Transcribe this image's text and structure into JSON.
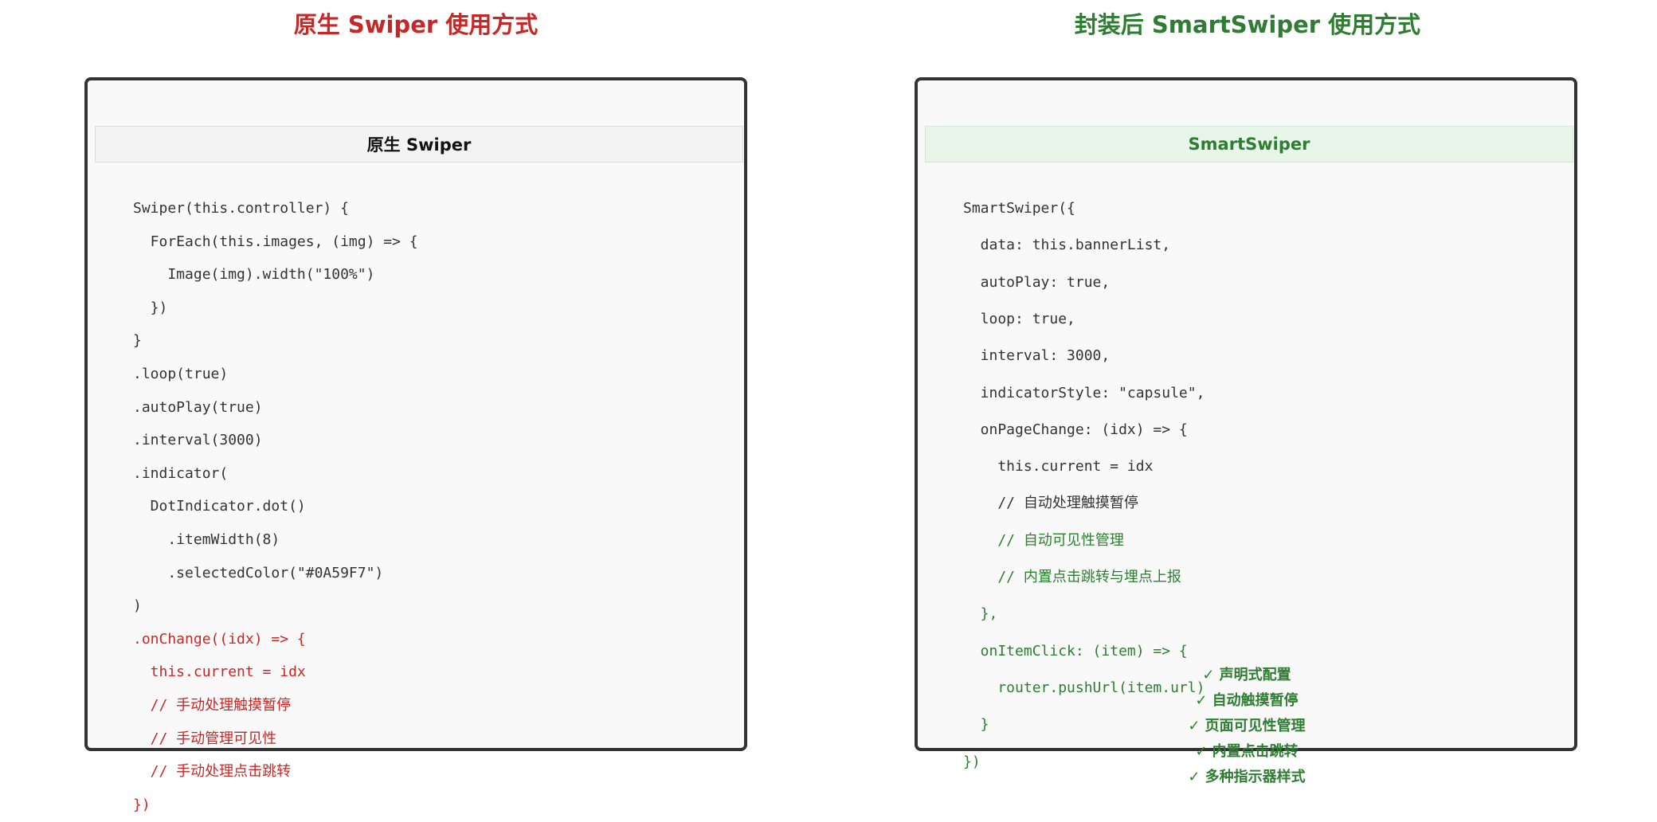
{
  "left": {
    "title": "原生 Swiper 使用方式",
    "header": "原生 Swiper",
    "code": [
      {
        "text": "Swiper(this.controller) {",
        "color": "normal"
      },
      {
        "text": "  ForEach(this.images, (img) => {",
        "color": "normal"
      },
      {
        "text": "    Image(img).width(\"100%\")",
        "color": "normal"
      },
      {
        "text": "  })",
        "color": "normal"
      },
      {
        "text": "}",
        "color": "normal"
      },
      {
        "text": ".loop(true)",
        "color": "normal"
      },
      {
        "text": ".autoPlay(true)",
        "color": "normal"
      },
      {
        "text": ".interval(3000)",
        "color": "normal"
      },
      {
        "text": ".indicator(",
        "color": "normal"
      },
      {
        "text": "  DotIndicator.dot()",
        "color": "normal"
      },
      {
        "text": "    .itemWidth(8)",
        "color": "normal"
      },
      {
        "text": "    .selectedColor(\"#0A59F7\")",
        "color": "normal"
      },
      {
        "text": ")",
        "color": "normal"
      },
      {
        "text": ".onChange((idx) => {",
        "color": "red"
      },
      {
        "text": "  this.current = idx",
        "color": "red"
      },
      {
        "text": "  // 手动处理触摸暂停",
        "color": "red"
      },
      {
        "text": "  // 手动管理可见性",
        "color": "red"
      },
      {
        "text": "  // 手动处理点击跳转",
        "color": "red"
      },
      {
        "text": "})",
        "color": "red"
      }
    ]
  },
  "right": {
    "title": "封装后 SmartSwiper 使用方式",
    "header": "SmartSwiper",
    "code": [
      {
        "text": "SmartSwiper({",
        "color": "normal"
      },
      {
        "text": "  data: this.bannerList,",
        "color": "normal"
      },
      {
        "text": "  autoPlay: true,",
        "color": "normal"
      },
      {
        "text": "  loop: true,",
        "color": "normal"
      },
      {
        "text": "  interval: 3000,",
        "color": "normal"
      },
      {
        "text": "  indicatorStyle: \"capsule\",",
        "color": "normal"
      },
      {
        "text": "  onPageChange: (idx) => {",
        "color": "normal"
      },
      {
        "text": "    this.current = idx",
        "color": "normal"
      },
      {
        "text": "    // 自动处理触摸暂停",
        "color": "normal"
      },
      {
        "text": "    // 自动可见性管理",
        "color": "green"
      },
      {
        "text": "    // 内置点击跳转与埋点上报",
        "color": "green"
      },
      {
        "text": "  },",
        "color": "green"
      },
      {
        "text": "  onItemClick: (item) => {",
        "color": "green"
      },
      {
        "text": "    router.pushUrl(item.url)",
        "color": "green"
      },
      {
        "text": "  }",
        "color": "green"
      },
      {
        "text": "})",
        "color": "green"
      }
    ],
    "features": [
      "✓ 声明式配置",
      "✓ 自动触摸暂停",
      "✓ 页面可见性管理",
      "✓ 内置点击跳转",
      "✓ 多种指示器样式"
    ]
  }
}
